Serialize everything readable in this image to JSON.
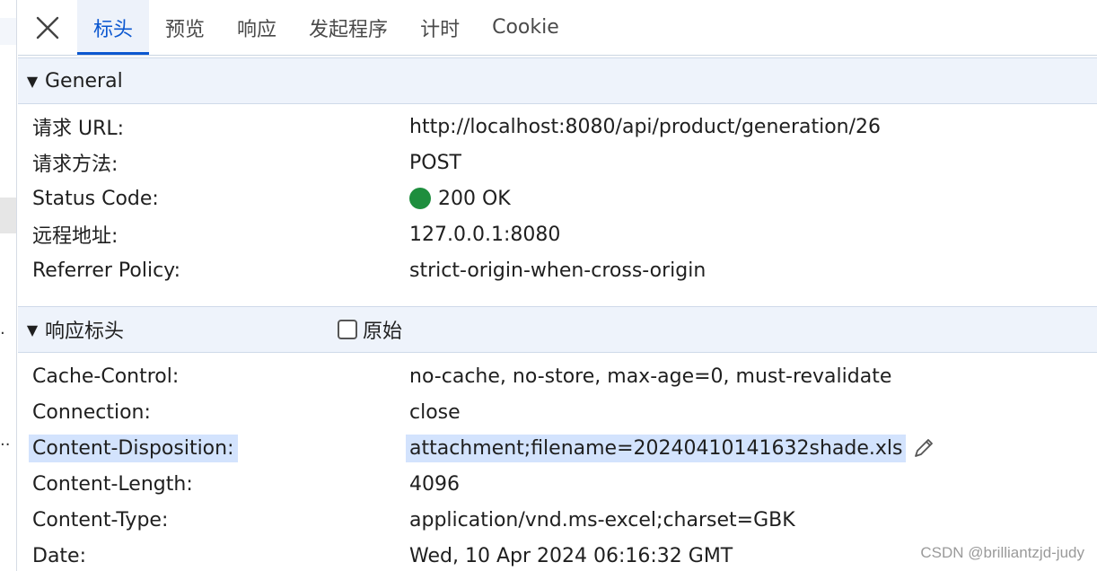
{
  "tabs": [
    {
      "label": "标头",
      "active": true
    },
    {
      "label": "预览",
      "active": false
    },
    {
      "label": "响应",
      "active": false
    },
    {
      "label": "发起程序",
      "active": false
    },
    {
      "label": "计时",
      "active": false
    },
    {
      "label": "Cookie",
      "active": false
    }
  ],
  "general": {
    "title": "General",
    "rows": [
      {
        "name": "请求 URL:",
        "value": "http://localhost:8080/api/product/generation/26"
      },
      {
        "name": "请求方法:",
        "value": "POST"
      },
      {
        "name": "Status Code:",
        "value": "200 OK",
        "status_color": "#1e8e3e"
      },
      {
        "name": "远程地址:",
        "value": "127.0.0.1:8080"
      },
      {
        "name": "Referrer Policy:",
        "value": "strict-origin-when-cross-origin"
      }
    ]
  },
  "response_headers": {
    "title": "响应标头",
    "raw_label": "原始",
    "rows": [
      {
        "name": "Cache-Control:",
        "value": "no-cache, no-store, max-age=0, must-revalidate"
      },
      {
        "name": "Connection:",
        "value": "close"
      },
      {
        "name": "Content-Disposition:",
        "value": "attachment;filename=20240410141632shade.xls",
        "highlighted": true
      },
      {
        "name": "Content-Length:",
        "value": "4096"
      },
      {
        "name": "Content-Type:",
        "value": "application/vnd.ms-excel;charset=GBK"
      },
      {
        "name": "Date:",
        "value": "Wed, 10 Apr 2024 06:16:32 GMT"
      }
    ]
  },
  "left_strip": {
    "truncations": [
      ".",
      ".."
    ]
  },
  "watermark": "CSDN @brilliantzjd-judy",
  "colors": {
    "accent": "#0b57d0",
    "highlight": "#d3e3fd",
    "section_bg": "#eef3fb"
  },
  "icons": {
    "close": "close-icon",
    "edit": "pencil-icon",
    "collapse": "caret-down-icon"
  }
}
